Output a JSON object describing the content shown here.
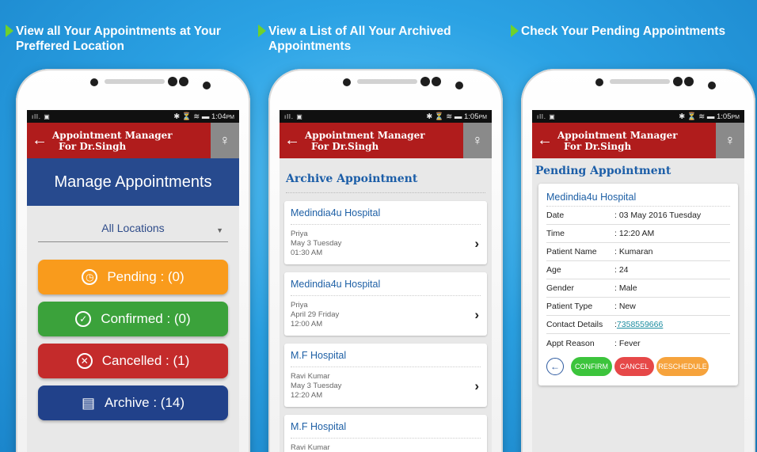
{
  "colors": {
    "accent_red": "#b01c1c",
    "navy": "#274a8e",
    "bg_blue": "#2aa2e6"
  },
  "panels": [
    {
      "caption": "View all Your Appointments at Your Preffered Location",
      "time": "1:04",
      "ampm": "PM"
    },
    {
      "caption": "View a List of All Your Archived Appointments",
      "time": "1:05",
      "ampm": "PM"
    },
    {
      "caption": "Check Your Pending Appointments",
      "time": "1:05",
      "ampm": "PM"
    }
  ],
  "status_sig": "ıll. ▣",
  "status_icons": "✱ ⏳ ≋ ▬",
  "appbar": {
    "title_line1": "Appointment Manager",
    "title_line2": "For Dr.Singh",
    "back_icon": "arrow-left-icon",
    "user_icon": "user-icon"
  },
  "screen1": {
    "heading": "Manage Appointments",
    "location": "All Locations",
    "buttons": [
      {
        "label": "Pending : (0)",
        "icon": "clock-icon"
      },
      {
        "label": "Confirmed : (0)",
        "icon": "check-icon"
      },
      {
        "label": "Cancelled : (1)",
        "icon": "x-icon"
      },
      {
        "label": "Archive : (14)",
        "icon": "archive-icon"
      }
    ]
  },
  "screen2": {
    "title": "Archive Appointment",
    "items": [
      {
        "hospital": "Medindia4u Hospital",
        "patient": "Priya",
        "date": "May 3 Tuesday",
        "time": "01:30 AM"
      },
      {
        "hospital": "Medindia4u Hospital",
        "patient": "Priya",
        "date": "April 29 Friday",
        "time": "12:00 AM"
      },
      {
        "hospital": "M.F Hospital",
        "patient": "Ravi Kumar",
        "date": "May 3 Tuesday",
        "time": "12:20 AM"
      },
      {
        "hospital": "M.F Hospital",
        "patient": "Ravi Kumar",
        "date": "",
        "time": ""
      }
    ]
  },
  "screen3": {
    "title": "Pending Appointment",
    "hospital": "Medindia4u Hospital",
    "rows": [
      {
        "k": "Date",
        "v": ": 03 May 2016 Tuesday"
      },
      {
        "k": "Time",
        "v": ": 12:20 AM"
      },
      {
        "k": "Patient Name",
        "v": ": Kumaran"
      },
      {
        "k": "Age",
        "v": ": 24"
      },
      {
        "k": "Gender",
        "v": ": Male"
      },
      {
        "k": "Patient Type",
        "v": ": New"
      }
    ],
    "contact_label": "Contact Details",
    "contact_colon": ": ",
    "contact_value": "7358559666",
    "reason_label": "Appt Reason",
    "reason_value": ": Fever",
    "confirm": "CONFIRM",
    "cancel": "CANCEL",
    "reschedule": "RESCHEDULE"
  }
}
